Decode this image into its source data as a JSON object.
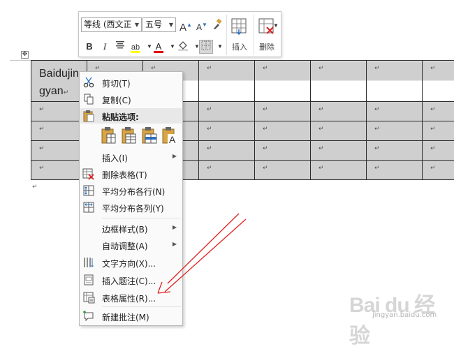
{
  "document": {
    "cell_text": "Baidujingyan",
    "cell_mark": "↵",
    "after_table_mark": "↵",
    "move_handle_glyph": "✥",
    "columns": 8,
    "rows": 5
  },
  "toolbar": {
    "font_name": "等线 (西文正",
    "font_size": "五号",
    "grow_font": "A",
    "shrink_font": "A",
    "bold": "B",
    "italic": "I",
    "font_color_glyph": "A",
    "insert_label": "插入",
    "delete_label": "删除",
    "colors": {
      "highlight": "#ffff00",
      "font": "#e00000"
    }
  },
  "context_menu": {
    "cut": "剪切(T)",
    "copy": "复制(C)",
    "paste_options": "粘贴选项:",
    "insert": "插入(I)",
    "delete_table": "删除表格(T)",
    "distribute_rows": "平均分布各行(N)",
    "distribute_columns": "平均分布各列(Y)",
    "border_styles": "边框样式(B)",
    "autofit": "自动调整(A)",
    "text_direction": "文字方向(X)...",
    "insert_caption": "插入题注(C)...",
    "table_properties": "表格属性(R)...",
    "new_comment": "新建批注(M)"
  },
  "watermark": {
    "brand": "Bai du 经验",
    "url": "jingyan.baidu.com"
  },
  "colors": {
    "arrow": "#e02020",
    "table_shade": "#cfcfcf"
  }
}
